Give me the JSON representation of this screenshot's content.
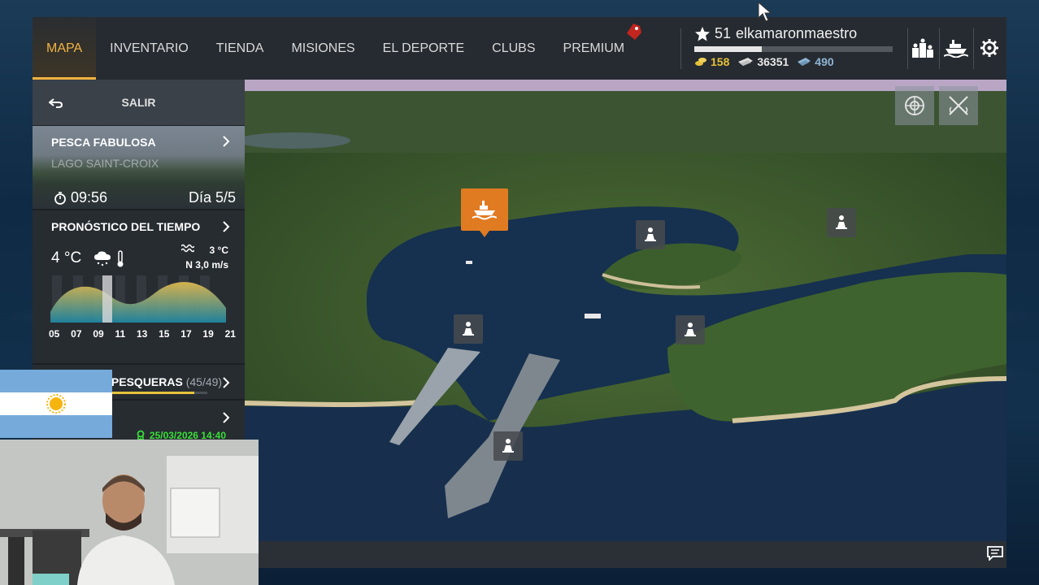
{
  "nav": {
    "tabs": [
      {
        "label": "MAPA",
        "active": true
      },
      {
        "label": "INVENTARIO",
        "active": false
      },
      {
        "label": "TIENDA",
        "active": false
      },
      {
        "label": "MISIONES",
        "active": false
      },
      {
        "label": "EL DEPORTE",
        "active": false
      },
      {
        "label": "CLUBS",
        "active": false
      },
      {
        "label": "PREMIUM",
        "active": false
      }
    ]
  },
  "player": {
    "level": "51",
    "name": "elkamaronmaestro",
    "xp_progress": 0.34,
    "gold": "158",
    "silver": "36351",
    "baitcoins": "490"
  },
  "header_icons": [
    "leaderboard-icon",
    "boat-icon",
    "gear-icon"
  ],
  "map_tools": [
    "compass-icon",
    "crossed-rods-icon"
  ],
  "panel": {
    "exit_label": "SALIR",
    "location": {
      "title": "PESCA FABULOSA",
      "subtitle": "LAGO SAINT-CROIX",
      "time": "09:56",
      "day": "Día 5/5"
    },
    "weather": {
      "title": "PRONÓSTICO DEL TIEMPO",
      "air_temp": "4 °C",
      "water_temp": "3 °C",
      "wind": "N 3,0 m/s",
      "hours": [
        "05",
        "07",
        "09",
        "11",
        "13",
        "15",
        "17",
        "19",
        "21"
      ]
    },
    "species": {
      "title": "ESPECIES PESQUERAS",
      "count": "(45/49)",
      "progress": 0.918
    },
    "date": "25/03/2026 14:40"
  },
  "colors": {
    "accent": "#f1b340",
    "base_marker": "#e07b22",
    "date_green": "#38e038",
    "gold": "#e7c13a",
    "baitcoin": "#8fb6d6"
  }
}
